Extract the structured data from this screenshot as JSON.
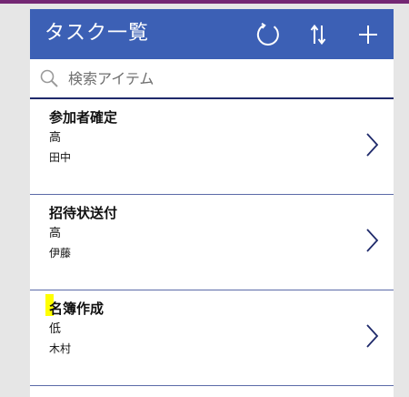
{
  "header": {
    "title": "タスク一覧",
    "icons": [
      "refresh-icon",
      "sort-icon",
      "add-icon"
    ]
  },
  "search": {
    "placeholder": "検索アイテム",
    "value": ""
  },
  "tasks": [
    {
      "title": "参加者確定",
      "priority": "高",
      "owner": "田中"
    },
    {
      "title": "招待状送付",
      "priority": "高",
      "owner": "伊藤"
    },
    {
      "title": "名簿作成",
      "priority": "低",
      "owner": "木村"
    }
  ],
  "colors": {
    "header": "#3c60b5",
    "top_strip": "#742774",
    "divider": "#5b6aa8",
    "highlight": "#ffff00"
  }
}
